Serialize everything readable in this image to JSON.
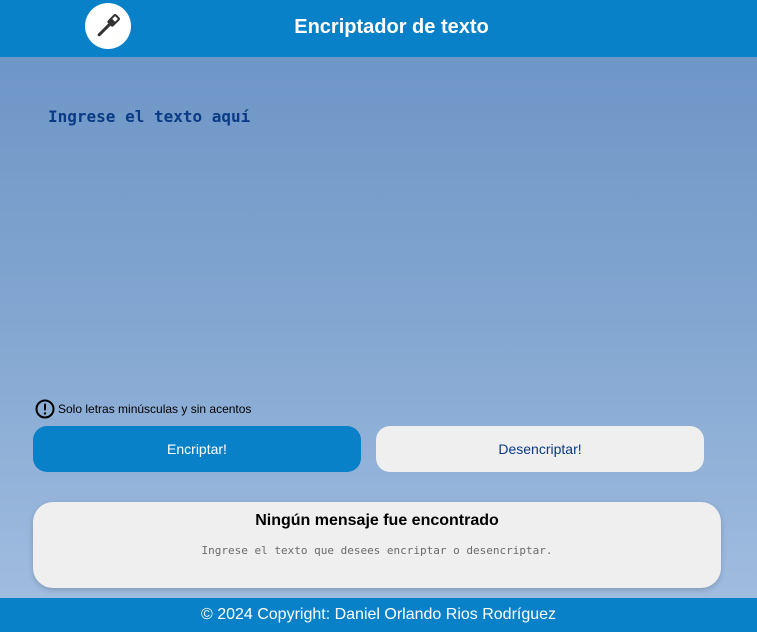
{
  "header": {
    "title": "Encriptador de texto",
    "logo_icon": "wrench-icon"
  },
  "input": {
    "placeholder": "Ingrese el texto aquí",
    "value": ""
  },
  "warning": {
    "icon": "exclamation-circle-icon",
    "text": "Solo letras minúsculas y sin acentos"
  },
  "buttons": {
    "encrypt_label": "Encriptar!",
    "decrypt_label": "Desencriptar!"
  },
  "result": {
    "title": "Ningún mensaje fue encontrado",
    "text": "Ingrese el texto que desees encriptar o desencriptar."
  },
  "footer": {
    "text": "© 2024 Copyright: Daniel Orlando Rios Rodríguez"
  },
  "colors": {
    "primary": "#0881c9",
    "text_dark_blue": "#0a3a85",
    "light_button": "#efefef"
  }
}
